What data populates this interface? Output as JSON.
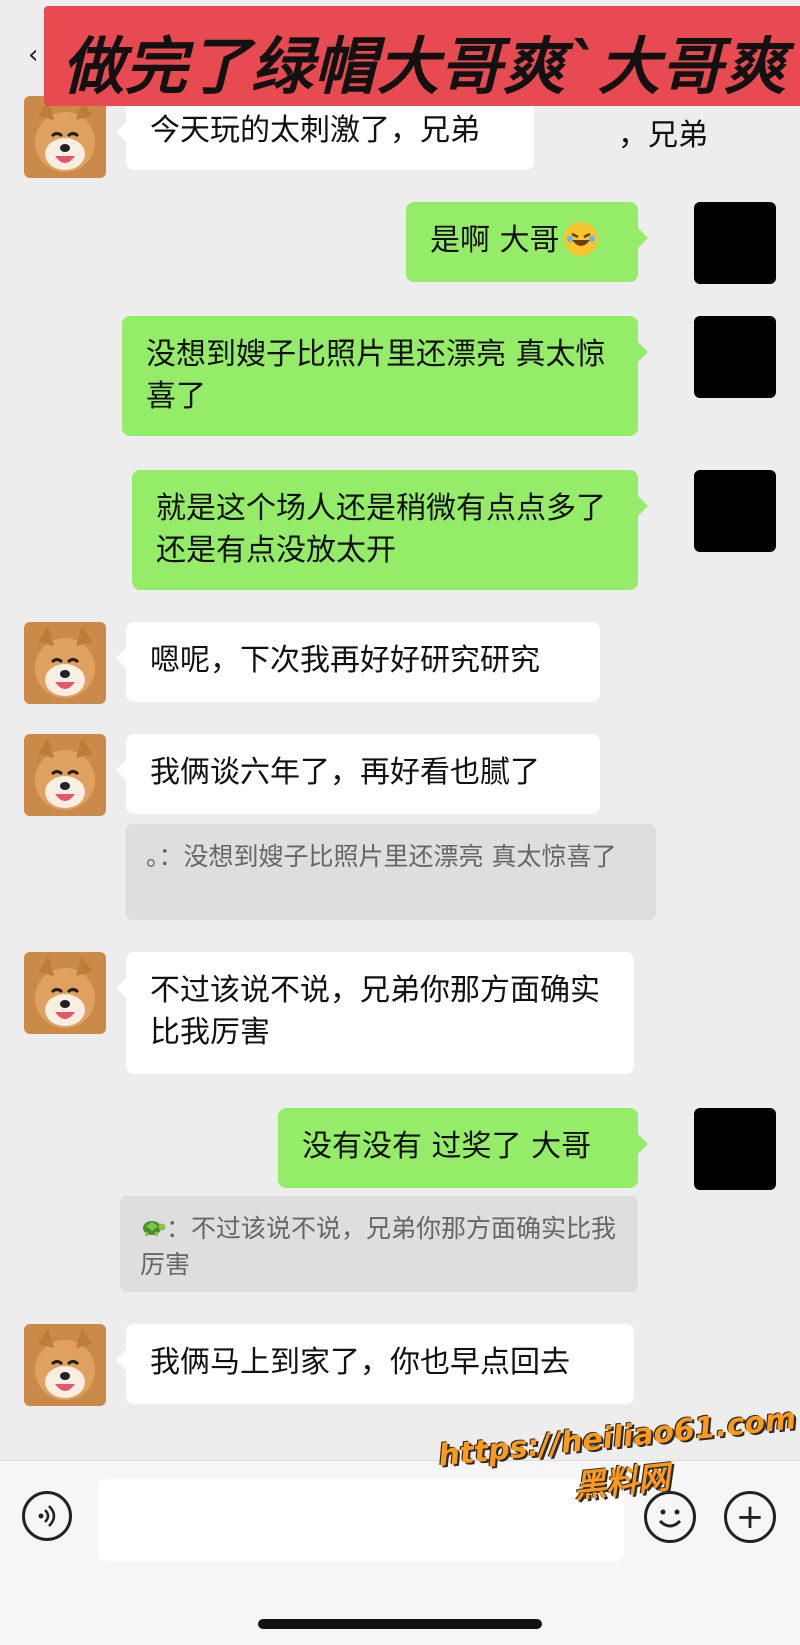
{
  "banner": {
    "title": "做完了绿帽大哥爽`大哥爽"
  },
  "header": {
    "back_icon": "chevron-left-icon"
  },
  "messages": [
    {
      "side": "left",
      "text": "今天玩的太刺激了，兄弟",
      "overflow_text": "，兄弟"
    },
    {
      "side": "right",
      "text": "是啊 大哥",
      "emoji": "rolling-on-floor-laughing-emoji"
    },
    {
      "side": "right",
      "text": "没想到嫂子比照片里还漂亮 真太惊喜了"
    },
    {
      "side": "right",
      "text": "就是这个场人还是稍微有点点多了 还是有点没放太开"
    },
    {
      "side": "left",
      "text": "嗯呢，下次我再好好研究研究"
    },
    {
      "side": "left",
      "text": "我俩谈六年了，再好看也腻了"
    },
    {
      "side": "left",
      "text": "不过该说不说，兄弟你那方面确实比我厉害"
    },
    {
      "side": "right",
      "text": "没有没有 过奖了 大哥"
    },
    {
      "side": "left",
      "text": "我俩马上到家了，你也早点回去"
    }
  ],
  "quotes": [
    {
      "sender": "。",
      "text": "：没想到嫂子比照片里还漂亮 真太惊喜了"
    },
    {
      "sender_icon": "turtle-emoji",
      "text": "：不过该说不说，兄弟你那方面确实比我厉害"
    }
  ],
  "input_bar": {
    "voice_icon": "voice-icon",
    "emoji_icon": "smiley-icon",
    "plus_icon": "plus-icon",
    "plus_glyph": "+"
  },
  "watermark": {
    "url": "https://heiliao61.com",
    "site": "黑料网"
  },
  "colors": {
    "my_bubble": "#95ec69",
    "their_bubble": "#ffffff",
    "background": "#ededed",
    "banner": "#e84a52"
  }
}
